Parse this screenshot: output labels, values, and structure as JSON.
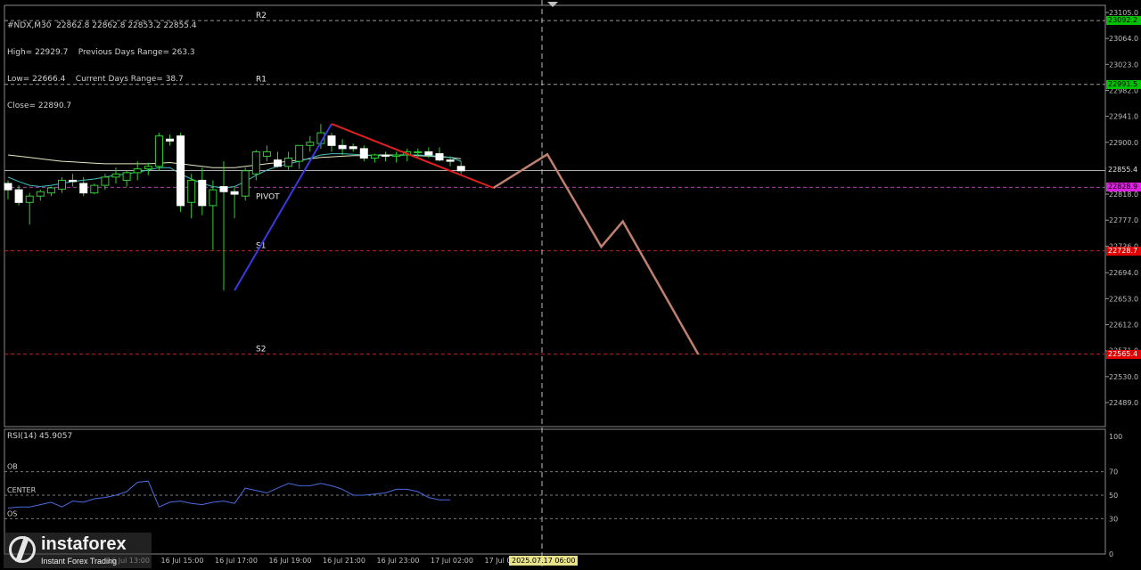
{
  "info": {
    "line1": "#NDX,M30  22862.8 22862.8 22853.2 22855.4",
    "line2": "High= 22929.7    Previous Days Range= 263.3",
    "line3": "Low= 22666.4    Current Days Range= 38.7",
    "line4": "Close= 22890.7"
  },
  "pivots": [
    {
      "label": "R2",
      "price": 23092.2,
      "tag": "23092.2",
      "color": "#00c000"
    },
    {
      "label": "R1",
      "price": 22991.5,
      "tag": "22991.5",
      "color": "#00c000"
    },
    {
      "label": "PIVOT",
      "price": 22828.9,
      "tag": "22828.9",
      "color": "#e020e0"
    },
    {
      "label": "S1",
      "price": 22728.7,
      "tag": "22728.7",
      "color": "#e00000"
    },
    {
      "label": "S2",
      "price": 22565.4,
      "tag": "22565.4",
      "color": "#e00000"
    }
  ],
  "current_price": {
    "value": 22855.4,
    "tag": "22855.4"
  },
  "rsi": {
    "title": "RSI(14) 45.9057",
    "levels": [
      {
        "label": "OB",
        "value": 70
      },
      {
        "label": "CENTER",
        "value": 50
      },
      {
        "label": "OS",
        "value": 30
      }
    ],
    "ticks": [
      100,
      70,
      50,
      30,
      0
    ],
    "values": [
      39,
      40,
      40,
      42,
      44,
      40,
      45,
      44,
      47,
      48,
      50,
      53,
      61,
      62,
      40,
      44,
      45,
      43,
      42,
      44,
      45,
      43,
      56,
      54,
      52,
      56,
      60,
      58,
      58,
      60,
      58,
      55,
      50,
      50,
      51,
      52,
      55,
      55,
      53,
      48,
      46,
      46
    ]
  },
  "marker_label": "2025.07.17 06:00",
  "logo": {
    "name": "instaforex",
    "sub": "Instant Forex Trading"
  },
  "chart_data": {
    "type": "candlestick",
    "symbol": "#NDX",
    "timeframe": "M30",
    "ylim": [
      22480,
      23113
    ],
    "y_ticks": [
      23105.0,
      23064.0,
      23023.0,
      22982.0,
      22941.0,
      22900.0,
      22859.0,
      22818.0,
      22777.0,
      22736.0,
      22694.0,
      22653.0,
      22612.0,
      22571.0,
      22530.0,
      22489.0
    ],
    "x_tick_labels": [
      "16 Jul 13:00",
      "16 Jul 15:00",
      "16 Jul 17:00",
      "16 Jul 19:00",
      "16 Jul 21:00",
      "16 Jul 23:00",
      "17 Jul 02:00",
      "17 Jul 04:00"
    ],
    "candles": [
      [
        22835,
        22840,
        22810,
        22825
      ],
      [
        22825,
        22832,
        22800,
        22805
      ],
      [
        22805,
        22820,
        22770,
        22815
      ],
      [
        22815,
        22825,
        22808,
        22822
      ],
      [
        22820,
        22830,
        22815,
        22828
      ],
      [
        22826,
        22845,
        22820,
        22840
      ],
      [
        22840,
        22850,
        22830,
        22838
      ],
      [
        22835,
        22845,
        22815,
        22820
      ],
      [
        22820,
        22835,
        22818,
        22832
      ],
      [
        22832,
        22850,
        22825,
        22845
      ],
      [
        22845,
        22860,
        22835,
        22850
      ],
      [
        22840,
        22855,
        22830,
        22852
      ],
      [
        22852,
        22870,
        22840,
        22858
      ],
      [
        22858,
        22868,
        22848,
        22862
      ],
      [
        22862,
        22915,
        22855,
        22910
      ],
      [
        22905,
        22912,
        22895,
        22902
      ],
      [
        22910,
        22915,
        22790,
        22800
      ],
      [
        22805,
        22850,
        22780,
        22840
      ],
      [
        22840,
        22860,
        22785,
        22800
      ],
      [
        22800,
        22840,
        22730,
        22825
      ],
      [
        22830,
        22870,
        22666,
        22822
      ],
      [
        22822,
        22830,
        22780,
        22818
      ],
      [
        22815,
        22860,
        22808,
        22855
      ],
      [
        22850,
        22888,
        22840,
        22885
      ],
      [
        22878,
        22895,
        22870,
        22885
      ],
      [
        22872,
        22885,
        22860,
        22862
      ],
      [
        22862,
        22885,
        22855,
        22875
      ],
      [
        22870,
        22895,
        22858,
        22895
      ],
      [
        22895,
        22910,
        22885,
        22900
      ],
      [
        22898,
        22929,
        22890,
        22915
      ],
      [
        22910,
        22915,
        22885,
        22895
      ],
      [
        22895,
        22905,
        22880,
        22890
      ],
      [
        22893,
        22898,
        22885,
        22890
      ],
      [
        22890,
        22895,
        22870,
        22875
      ],
      [
        22875,
        22882,
        22868,
        22880
      ],
      [
        22880,
        22885,
        22870,
        22878
      ],
      [
        22878,
        22885,
        22868,
        22880
      ],
      [
        22880,
        22890,
        22870,
        22885
      ],
      [
        22885,
        22890,
        22875,
        22885
      ],
      [
        22885,
        22892,
        22875,
        22880
      ],
      [
        22882,
        22892,
        22870,
        22872
      ],
      [
        22872,
        22878,
        22862,
        22870
      ],
      [
        22862,
        22870,
        22850,
        22855
      ]
    ],
    "ma_slow": [
      22880,
      22878,
      22876,
      22874,
      22872,
      22870,
      22869,
      22868,
      22867,
      22866,
      22866,
      22866,
      22866,
      22866,
      22867,
      22868,
      22866,
      22864,
      22862,
      22860,
      22860,
      22860,
      22862,
      22864,
      22866,
      22868,
      22870,
      22872,
      22874,
      22876,
      22877,
      22878,
      22879,
      22879,
      22880,
      22880,
      22880,
      22880,
      22879,
      22878,
      22877,
      22876,
      22874
    ],
    "ma_fast": [
      22845,
      22838,
      22832,
      22830,
      22832,
      22835,
      22838,
      22840,
      22842,
      22845,
      22848,
      22850,
      22853,
      22856,
      22860,
      22860,
      22850,
      22842,
      22835,
      22830,
      22828,
      22830,
      22838,
      22848,
      22856,
      22862,
      22866,
      22870,
      22875,
      22880,
      22882,
      22882,
      22881,
      22880,
      22879,
      22879,
      22879,
      22880,
      22880,
      22879,
      22878,
      22876,
      22870
    ],
    "lines": [
      {
        "name": "swing-up",
        "color": "#3a3adf",
        "points": [
          [
            21,
            22666
          ],
          [
            30,
            22929
          ]
        ]
      },
      {
        "name": "swing-down",
        "color": "#e02020",
        "points": [
          [
            30,
            22929
          ],
          [
            45,
            22828
          ]
        ]
      },
      {
        "name": "projection",
        "color": "#c08070",
        "points": [
          [
            45,
            22828
          ],
          [
            50,
            22881
          ],
          [
            55,
            22735
          ],
          [
            57,
            22775
          ],
          [
            64,
            22565
          ]
        ]
      }
    ]
  }
}
